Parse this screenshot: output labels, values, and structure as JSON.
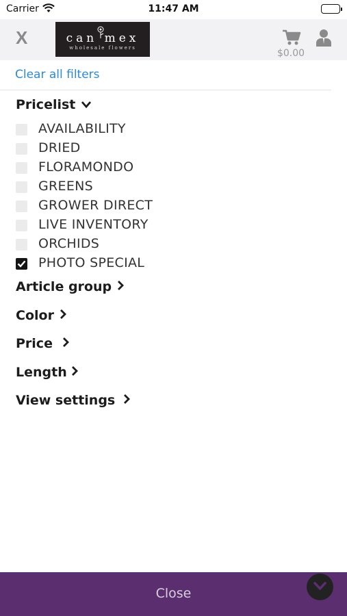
{
  "status": {
    "carrier": "Carrier",
    "time": "11:47 AM"
  },
  "header": {
    "close": "X",
    "logo_main": "can mex",
    "logo_sub": "wholesale flowers",
    "cart_total": "$0.00"
  },
  "clear_filters": "Clear all filters",
  "pricelist": {
    "heading": "Pricelist",
    "options": [
      {
        "label": "AVAILABILITY",
        "checked": false
      },
      {
        "label": "DRIED",
        "checked": false
      },
      {
        "label": "FLORAMONDO",
        "checked": false
      },
      {
        "label": "GREENS",
        "checked": false
      },
      {
        "label": "GROWER DIRECT",
        "checked": false
      },
      {
        "label": "LIVE INVENTORY",
        "checked": false
      },
      {
        "label": "ORCHIDS",
        "checked": false
      },
      {
        "label": "PHOTO SPECIAL",
        "checked": true
      }
    ]
  },
  "sections": {
    "article_group": "Article group",
    "color": "Color",
    "price": "Price",
    "length": "Length",
    "view_settings": "View settings"
  },
  "footer": {
    "close": "Close"
  },
  "colors": {
    "accent_link": "#2b8ad9",
    "footer_bg": "#5b2e6f"
  }
}
